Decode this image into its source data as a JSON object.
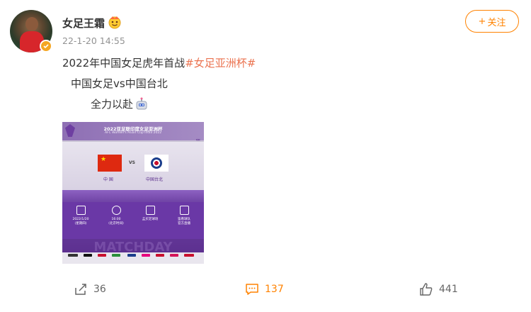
{
  "user": {
    "name": "女足王霜",
    "timestamp": "22-1-20 14:55"
  },
  "follow_button": {
    "plus": "+",
    "label": "关注"
  },
  "post": {
    "line1_prefix": "2022年中国女足虎年首战",
    "line1_hashtag": "#女足亚洲杯#",
    "line2": "中国女足vs中国台北",
    "line3": "全力以赴"
  },
  "poster": {
    "title": "2022亚足联印度女足亚洲杯",
    "subtitle": "AFC Women's Asian Cup India 2022",
    "arrows": "‹‹‹‹",
    "vs": "VS",
    "team_home": "中 国",
    "team_away": "中国台北",
    "info": [
      {
        "icon": "calendar-icon",
        "text": "2022/1/20\n(星期四)"
      },
      {
        "icon": "clock-icon",
        "text": "16:00\n(北京时间)"
      },
      {
        "icon": "pitch-icon",
        "text": "孟买足球场"
      },
      {
        "icon": "live-icon",
        "text": "鉴看球队\n官方直播"
      }
    ],
    "matchday": "MATCHDAY"
  },
  "actions": {
    "share_count": "36",
    "comment_count": "137",
    "like_count": "441"
  },
  "colors": {
    "accent": "#ff8200",
    "hashtag": "#eb7350",
    "poster_purple": "#6a38a6",
    "verified": "#f5a623"
  }
}
